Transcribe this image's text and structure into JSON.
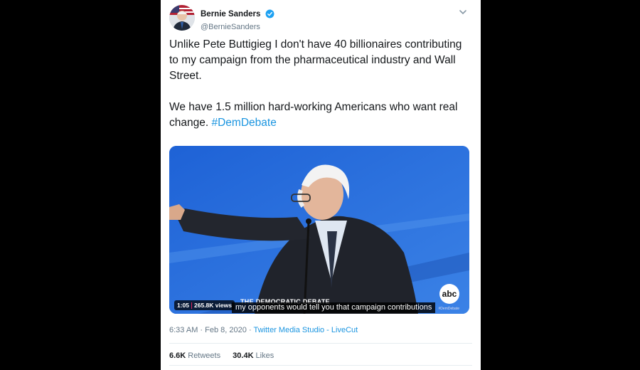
{
  "author": {
    "display_name": "Bernie Sanders",
    "handle": "@BernieSanders",
    "verified": true,
    "avatar_icon": "avatar-portrait"
  },
  "tweet": {
    "paragraph1": "Unlike Pete Buttigieg I don't have 40 billionaires contributing to my campaign from the pharmaceutical industry and Wall Street.",
    "paragraph2_text": "We have 1.5 million hard-working Americans who want real change.",
    "hashtag": "#DemDebate"
  },
  "media": {
    "duration": "1:05",
    "views": "265.8K views",
    "lower_third": "THE DEMOCRATIC DEBATE",
    "caption": "my opponents would tell you that campaign contributions",
    "network_logo": "abc",
    "network_sub": "#DemDebate"
  },
  "meta": {
    "time": "6:33 AM",
    "dot": "·",
    "date": "Feb 8, 2020",
    "source": "Twitter Media Studio - LiveCut"
  },
  "stats": {
    "retweets_count": "6.6K",
    "retweets_label": "Retweets",
    "likes_count": "30.4K",
    "likes_label": "Likes"
  },
  "colors": {
    "link": "#1b95e0",
    "stage_blue": "#2f6fd1",
    "verified": "#1da1f2"
  }
}
